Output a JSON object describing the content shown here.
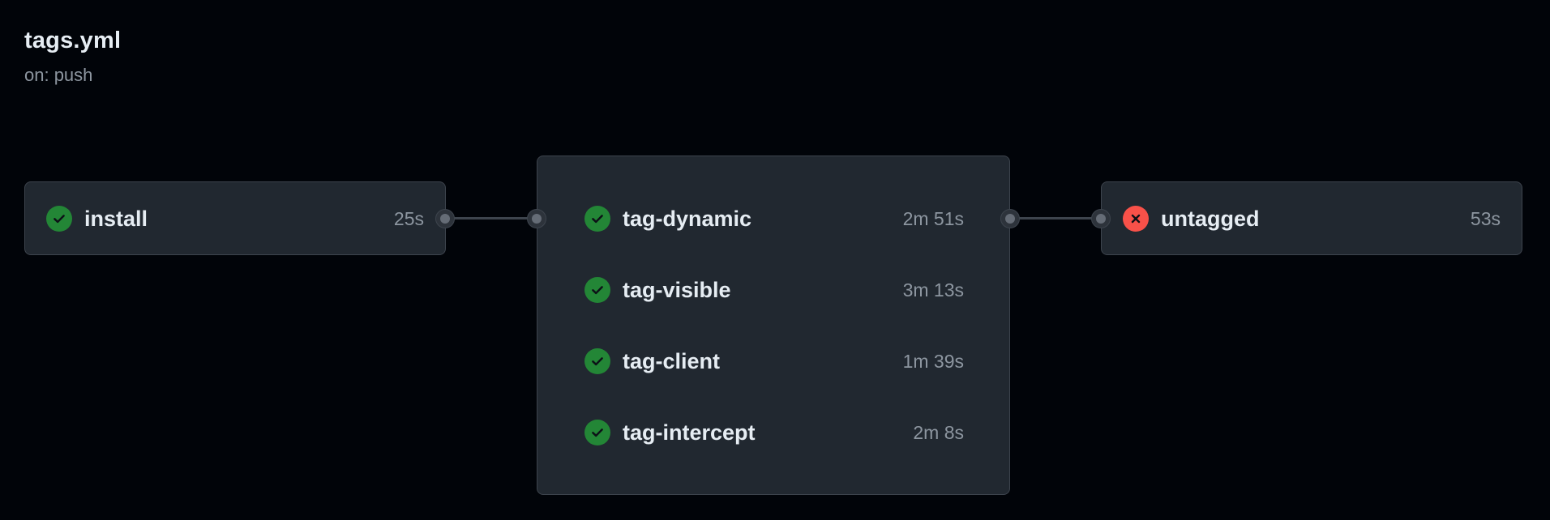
{
  "workflow": {
    "title": "tags.yml",
    "trigger": "on: push"
  },
  "jobs": {
    "install": {
      "name": "install",
      "duration": "25s",
      "status": "success"
    },
    "matrix": [
      {
        "name": "tag-dynamic",
        "duration": "2m 51s",
        "status": "success"
      },
      {
        "name": "tag-visible",
        "duration": "3m 13s",
        "status": "success"
      },
      {
        "name": "tag-client",
        "duration": "1m 39s",
        "status": "success"
      },
      {
        "name": "tag-intercept",
        "duration": "2m 8s",
        "status": "success"
      }
    ],
    "untagged": {
      "name": "untagged",
      "duration": "53s",
      "status": "failure"
    }
  },
  "icons": {
    "success": "check-circle-icon",
    "failure": "x-circle-icon"
  },
  "colors": {
    "background": "#010409",
    "card": "#212830",
    "border": "#3d444d",
    "success": "#238636",
    "failure": "#f85149",
    "text_primary": "#e6edf3",
    "text_muted": "#8d96a0"
  }
}
